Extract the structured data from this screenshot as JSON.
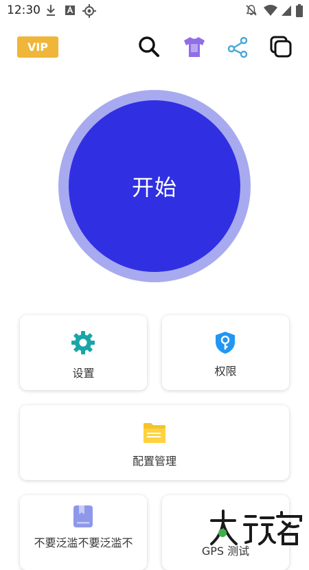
{
  "status_bar": {
    "time": "12:30",
    "left_icons": [
      "download-icon",
      "font-a-icon",
      "gps-icon"
    ],
    "right_icons": [
      "notifications-off-icon",
      "wifi-icon",
      "signal-icon",
      "battery-icon"
    ]
  },
  "top_bar": {
    "vip_label": "VIP",
    "icons": [
      "search-icon",
      "theme-shirt-icon",
      "share-icon",
      "copy-icon"
    ]
  },
  "start_button": {
    "label": "开始"
  },
  "cards": {
    "settings": {
      "label": "设置",
      "icon": "gear-icon",
      "icon_color": "#1aa5a8"
    },
    "permissions": {
      "label": "权限",
      "icon": "shield-key-icon",
      "icon_color": "#2196f3"
    },
    "config": {
      "label": "配置管理",
      "icon": "folder-icon",
      "icon_color": "#f5c32c"
    },
    "no_flood": {
      "label": "不要泛滥不要泛滥不",
      "icon": "bookmark-doc-icon",
      "icon_color": "#8e98ea"
    },
    "gps_test": {
      "label": "GPS 测试"
    }
  },
  "watermark": {
    "text": "大玩客"
  },
  "colors": {
    "accent": "#3030e2",
    "accent_ring": "#a8aaf0",
    "vip": "#f0b63a",
    "theme_icon": "#8f6ee8",
    "share_icon": "#4aa8d8"
  }
}
